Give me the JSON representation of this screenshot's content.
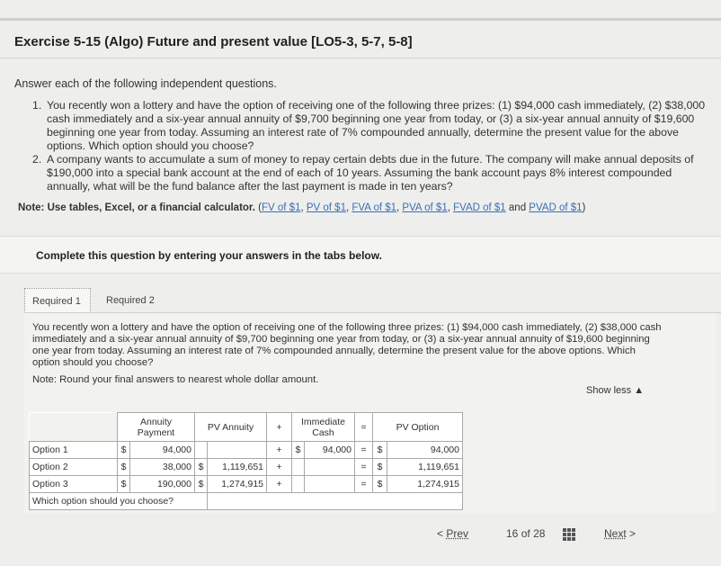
{
  "title": "Exercise 5-15 (Algo) Future and present value [LO5-3, 5-7, 5-8]",
  "instructions": "Answer each of the following independent questions.",
  "questions": [
    {
      "num": "1.",
      "text": "You recently won a lottery and have the option of receiving one of the following three prizes: (1) $94,000 cash immediately, (2) $38,000 cash immediately and a six-year annual annuity of $9,700 beginning one year from today, or (3) a six-year annual annuity of $19,600 beginning one year from today. Assuming an interest rate of 7% compounded annually, determine the present value for the above options. Which option should you choose?"
    },
    {
      "num": "2.",
      "text": "A company wants to accumulate a sum of money to repay certain debts due in the future. The company will make annual deposits of $190,000 into a special bank account at the end of each of 10 years. Assuming the bank account pays 8% interest compounded annually, what will be the fund balance after the last payment is made in ten years?"
    }
  ],
  "note": {
    "prefix": "Note: Use tables, Excel, or a financial calculator.",
    "links": [
      "FV of $1",
      "PV of $1",
      "FVA of $1",
      "PVA of $1",
      "FVAD of $1"
    ],
    "and": "and",
    "last_link": "PVAD of $1"
  },
  "complete": "Complete this question by entering your answers in the tabs below.",
  "tabs": [
    "Required 1",
    "Required 2"
  ],
  "panel": {
    "text": "You recently won a lottery and have the option of receiving one of the following three prizes: (1) $94,000 cash immediately, (2) $38,000 cash immediately and a six-year annual annuity of $9,700 beginning one year from today, or (3) a six-year annual annuity of $19,600 beginning one year from today. Assuming an interest rate of 7% compounded annually, determine the present value for the above options. Which option should you choose?",
    "note": "Note: Round your final answers to nearest whole dollar amount.",
    "show_less": "Show less"
  },
  "table": {
    "headers": {
      "annuity_payment": "Annuity Payment",
      "pv_annuity": "PV Annuity",
      "plus": "+",
      "immediate_cash": "Immediate Cash",
      "equals": "=",
      "pv_option": "PV Option"
    },
    "rows": [
      {
        "label": "Option 1",
        "dollar": "$",
        "payment": "94,000",
        "pv_dollar": "",
        "pv_annuity": "",
        "op": "+",
        "imm_dollar": "$",
        "immediate": "94,000",
        "eq": "=",
        "pvo_dollar": "$",
        "pv_option": "94,000"
      },
      {
        "label": "Option 2",
        "dollar": "$",
        "payment": "38,000",
        "pv_dollar": "$",
        "pv_annuity": "1,119,651",
        "op": "+",
        "imm_dollar": "",
        "immediate": "",
        "eq": "=",
        "pvo_dollar": "$",
        "pv_option": "1,119,651"
      },
      {
        "label": "Option 3",
        "dollar": "$",
        "payment": "190,000",
        "pv_dollar": "$",
        "pv_annuity": "1,274,915",
        "op": "+",
        "imm_dollar": "",
        "immediate": "",
        "eq": "=",
        "pvo_dollar": "$",
        "pv_option": "1,274,915"
      }
    ],
    "choice_label": "Which option should you choose?",
    "choice_value": ""
  },
  "nav": {
    "prev": "Prev",
    "page_current": "16",
    "page_of": "of",
    "page_total": "28",
    "next": "Next"
  }
}
